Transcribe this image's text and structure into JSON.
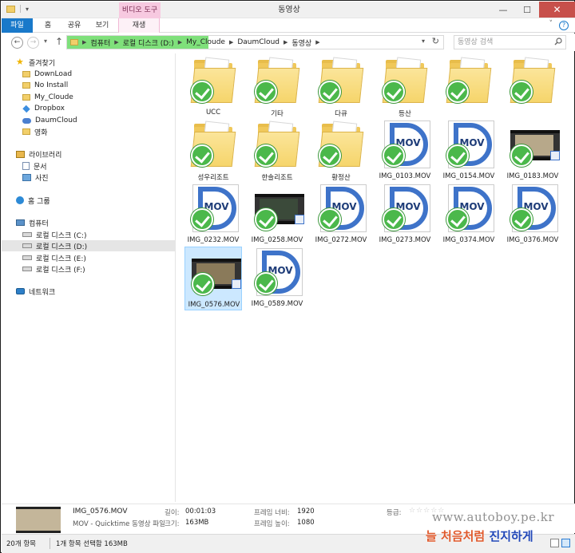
{
  "window": {
    "title": "동영상",
    "context_tab": "비디오 도구",
    "controls": {
      "minimize": "—",
      "maximize": "☐",
      "close": "✕"
    }
  },
  "ribbon": {
    "tabs": [
      "파일",
      "홈",
      "공유",
      "보기",
      "재생"
    ],
    "help": "?"
  },
  "address": {
    "path": [
      "컴퓨터",
      "로컬 디스크 (D:)",
      "My_Cloude",
      "DaumCloud",
      "동영상"
    ],
    "search_placeholder": "동영상 검색"
  },
  "sidebar": {
    "favorites_label": "즐겨찾기",
    "favorites": [
      "DownLoad",
      "No Install",
      "My_Cloude",
      "Dropbox",
      "DaumCloud",
      "영화"
    ],
    "libraries_label": "라이브러리",
    "libraries": [
      "문서",
      "사진"
    ],
    "homegroup_label": "홈 그룹",
    "computer_label": "컴퓨터",
    "drives": [
      "로컬 디스크 (C:)",
      "로컬 디스크 (D:)",
      "로컬 디스크 (E:)",
      "로컬 디스크 (F:)"
    ],
    "network_label": "네트워크"
  },
  "items": [
    {
      "name": "UCC",
      "kind": "folder"
    },
    {
      "name": "기타",
      "kind": "folder"
    },
    {
      "name": "다큐",
      "kind": "folder"
    },
    {
      "name": "등산",
      "kind": "folder"
    },
    {
      "name": "",
      "kind": "folder"
    },
    {
      "name": "",
      "kind": "folder"
    },
    {
      "name": "성우리조트",
      "kind": "folder"
    },
    {
      "name": "한솔리조트",
      "kind": "folder"
    },
    {
      "name": "황정산",
      "kind": "folder"
    },
    {
      "name": "IMG_0103.MOV",
      "kind": "mov"
    },
    {
      "name": "IMG_0154.MOV",
      "kind": "mov"
    },
    {
      "name": "IMG_0183.MOV",
      "kind": "video"
    },
    {
      "name": "IMG_0232.MOV",
      "kind": "mov"
    },
    {
      "name": "IMG_0258.MOV",
      "kind": "video"
    },
    {
      "name": "IMG_0272.MOV",
      "kind": "mov"
    },
    {
      "name": "IMG_0273.MOV",
      "kind": "mov"
    },
    {
      "name": "IMG_0374.MOV",
      "kind": "mov"
    },
    {
      "name": "IMG_0376.MOV",
      "kind": "mov"
    },
    {
      "name": "IMG_0576.MOV",
      "kind": "video",
      "selected": true
    },
    {
      "name": "IMG_0589.MOV",
      "kind": "mov"
    }
  ],
  "mov_label": "MOV",
  "details": {
    "file_name": "IMG_0576.MOV",
    "file_type": "MOV - Quicktime 동영상 파일",
    "length_label": "길이:",
    "length_value": "00:01:03",
    "size_label": "크기:",
    "size_value": "163MB",
    "width_label": "프레임 너비:",
    "width_value": "1920",
    "height_label": "프레임 높이:",
    "height_value": "1080",
    "rating_label": "등급:",
    "rating_value": 0
  },
  "status": {
    "count": "20개 항목",
    "selection": "1개 항목 선택함 163MB"
  },
  "watermark": {
    "url": "www.autoboy.pe.kr",
    "slogan_1": "늘 처음처럼 ",
    "slogan_2": "진지하게"
  },
  "colors": {
    "file_tab": "#1979ca",
    "context_tab": "#f7c9e0",
    "address_highlight": "#7fe07b",
    "check_green": "#4bb84b",
    "selection": "#cce8ff",
    "close_button": "#c7504b"
  }
}
